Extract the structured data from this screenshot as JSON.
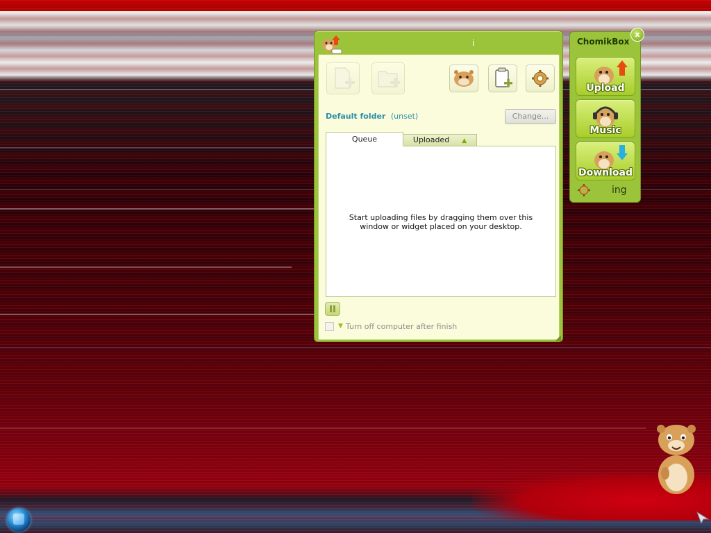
{
  "main_window": {
    "title": "i",
    "toolbar": {
      "add_file_icon": "add-file-icon",
      "add_folder_icon": "add-folder-icon",
      "chomik_icon": "hamster-icon",
      "paste_icon": "clipboard-add-icon",
      "settings_icon": "gear-icon"
    },
    "default_folder": {
      "label": "Default folder",
      "value": "(unset)",
      "change_label": "Change..."
    },
    "tabs": [
      {
        "label": "Queue",
        "active": true
      },
      {
        "label": "Uploaded",
        "active": false,
        "sort_indicator": "▲"
      }
    ],
    "empty_message": "Start uploading files by dragging them over this window or widget placed on your desktop.",
    "pause_icon": "pause-icon",
    "shutdown": {
      "checked": false,
      "label": "Turn off computer after finish",
      "arrow": "▼"
    }
  },
  "widget": {
    "title_part1": "Chomik",
    "title_part2": "Box",
    "close_label": "x",
    "buttons": [
      {
        "label": "Upload",
        "icon": "hamster-upload-icon"
      },
      {
        "label": "Music",
        "icon": "hamster-headphones-icon"
      },
      {
        "label": "Download",
        "icon": "hamster-download-icon"
      }
    ],
    "status_text": "ing"
  },
  "colors": {
    "window_green": "#9cc43a",
    "client_bg": "#fbfcdc",
    "accent_teal": "#2b8fa8",
    "upload_arrow": "#e84a10",
    "download_arrow": "#2ab0e0"
  }
}
